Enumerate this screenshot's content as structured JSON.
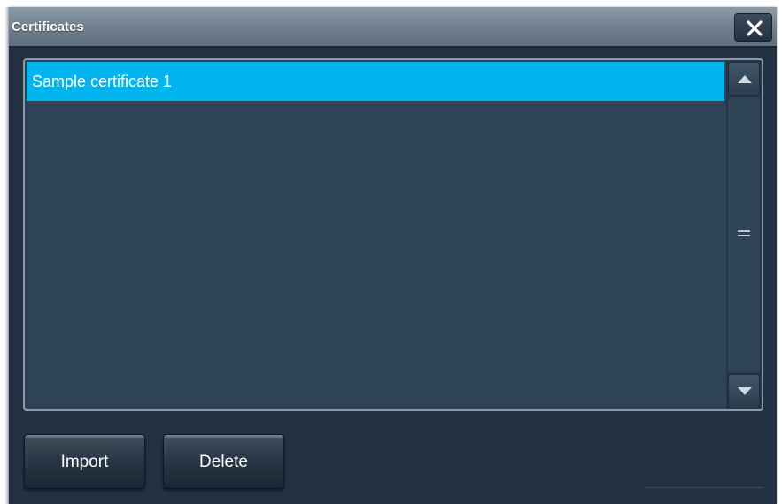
{
  "dialog": {
    "title": "Certificates",
    "close_icon": "close-icon"
  },
  "certificates": {
    "items": [
      {
        "label": "Sample certificate 1",
        "selected": true
      }
    ]
  },
  "scrollbar": {
    "up_icon": "triangle-up-icon",
    "down_icon": "triangle-down-icon",
    "grip_icon": "grip-lines-icon"
  },
  "actions": {
    "import_label": "Import",
    "delete_label": "Delete"
  },
  "colors": {
    "selection": "#00b4f0",
    "panel": "#2f4459",
    "background": "#233142"
  }
}
